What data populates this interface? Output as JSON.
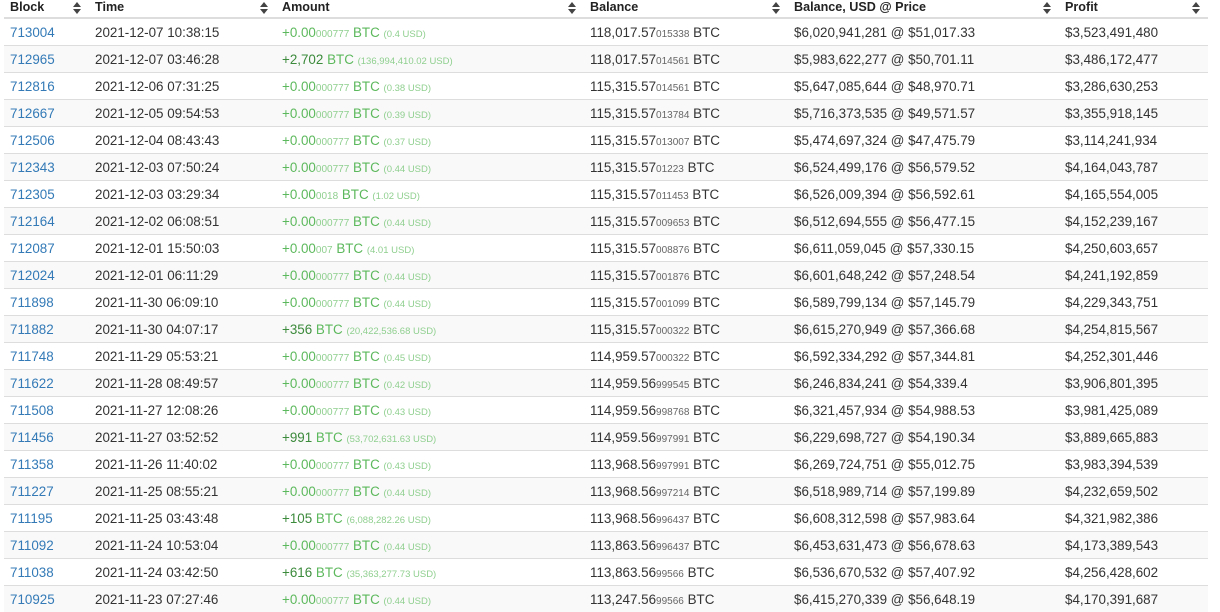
{
  "table": {
    "headers": [
      "Block",
      "Time",
      "Amount",
      "Balance",
      "Balance, USD @ Price",
      "Profit"
    ],
    "rows": [
      {
        "block": "713004",
        "time": "2021-12-07 10:38:15",
        "amt_main": "+0.00",
        "amt_small": "000777",
        "amt_unit": "BTC",
        "amt_usd": "(0.4 USD)",
        "bal_main": "118,017.57",
        "bal_small": "015338",
        "bal_unit": "BTC",
        "usd_price": "$6,020,941,281 @ $51,017.33",
        "profit": "$3,523,491,480"
      },
      {
        "block": "712965",
        "time": "2021-12-07 03:46:28",
        "amt_main": "+2,702",
        "amt_small": "",
        "amt_unit": "BTC",
        "amt_usd": "(136,994,410.02 USD)",
        "bal_main": "118,017.57",
        "bal_small": "014561",
        "bal_unit": "BTC",
        "usd_price": "$5,983,622,277 @ $50,701.11",
        "profit": "$3,486,172,477"
      },
      {
        "block": "712816",
        "time": "2021-12-06 07:31:25",
        "amt_main": "+0.00",
        "amt_small": "000777",
        "amt_unit": "BTC",
        "amt_usd": "(0.38 USD)",
        "bal_main": "115,315.57",
        "bal_small": "014561",
        "bal_unit": "BTC",
        "usd_price": "$5,647,085,644 @ $48,970.71",
        "profit": "$3,286,630,253"
      },
      {
        "block": "712667",
        "time": "2021-12-05 09:54:53",
        "amt_main": "+0.00",
        "amt_small": "000777",
        "amt_unit": "BTC",
        "amt_usd": "(0.39 USD)",
        "bal_main": "115,315.57",
        "bal_small": "013784",
        "bal_unit": "BTC",
        "usd_price": "$5,716,373,535 @ $49,571.57",
        "profit": "$3,355,918,145"
      },
      {
        "block": "712506",
        "time": "2021-12-04 08:43:43",
        "amt_main": "+0.00",
        "amt_small": "000777",
        "amt_unit": "BTC",
        "amt_usd": "(0.37 USD)",
        "bal_main": "115,315.57",
        "bal_small": "013007",
        "bal_unit": "BTC",
        "usd_price": "$5,474,697,324 @ $47,475.79",
        "profit": "$3,114,241,934"
      },
      {
        "block": "712343",
        "time": "2021-12-03 07:50:24",
        "amt_main": "+0.00",
        "amt_small": "000777",
        "amt_unit": "BTC",
        "amt_usd": "(0.44 USD)",
        "bal_main": "115,315.57",
        "bal_small": "01223",
        "bal_unit": "BTC",
        "usd_price": "$6,524,499,176 @ $56,579.52",
        "profit": "$4,164,043,787"
      },
      {
        "block": "712305",
        "time": "2021-12-03 03:29:34",
        "amt_main": "+0.00",
        "amt_small": "0018",
        "amt_unit": "BTC",
        "amt_usd": "(1.02 USD)",
        "bal_main": "115,315.57",
        "bal_small": "011453",
        "bal_unit": "BTC",
        "usd_price": "$6,526,009,394 @ $56,592.61",
        "profit": "$4,165,554,005"
      },
      {
        "block": "712164",
        "time": "2021-12-02 06:08:51",
        "amt_main": "+0.00",
        "amt_small": "000777",
        "amt_unit": "BTC",
        "amt_usd": "(0.44 USD)",
        "bal_main": "115,315.57",
        "bal_small": "009653",
        "bal_unit": "BTC",
        "usd_price": "$6,512,694,555 @ $56,477.15",
        "profit": "$4,152,239,167"
      },
      {
        "block": "712087",
        "time": "2021-12-01 15:50:03",
        "amt_main": "+0.00",
        "amt_small": "007",
        "amt_unit": "BTC",
        "amt_usd": "(4.01 USD)",
        "bal_main": "115,315.57",
        "bal_small": "008876",
        "bal_unit": "BTC",
        "usd_price": "$6,611,059,045 @ $57,330.15",
        "profit": "$4,250,603,657"
      },
      {
        "block": "712024",
        "time": "2021-12-01 06:11:29",
        "amt_main": "+0.00",
        "amt_small": "000777",
        "amt_unit": "BTC",
        "amt_usd": "(0.44 USD)",
        "bal_main": "115,315.57",
        "bal_small": "001876",
        "bal_unit": "BTC",
        "usd_price": "$6,601,648,242 @ $57,248.54",
        "profit": "$4,241,192,859"
      },
      {
        "block": "711898",
        "time": "2021-11-30 06:09:10",
        "amt_main": "+0.00",
        "amt_small": "000777",
        "amt_unit": "BTC",
        "amt_usd": "(0.44 USD)",
        "bal_main": "115,315.57",
        "bal_small": "001099",
        "bal_unit": "BTC",
        "usd_price": "$6,589,799,134 @ $57,145.79",
        "profit": "$4,229,343,751"
      },
      {
        "block": "711882",
        "time": "2021-11-30 04:07:17",
        "amt_main": "+356",
        "amt_small": "",
        "amt_unit": "BTC",
        "amt_usd": "(20,422,536.68 USD)",
        "bal_main": "115,315.57",
        "bal_small": "000322",
        "bal_unit": "BTC",
        "usd_price": "$6,615,270,949 @ $57,366.68",
        "profit": "$4,254,815,567"
      },
      {
        "block": "711748",
        "time": "2021-11-29 05:53:21",
        "amt_main": "+0.00",
        "amt_small": "000777",
        "amt_unit": "BTC",
        "amt_usd": "(0.45 USD)",
        "bal_main": "114,959.57",
        "bal_small": "000322",
        "bal_unit": "BTC",
        "usd_price": "$6,592,334,292 @ $57,344.81",
        "profit": "$4,252,301,446"
      },
      {
        "block": "711622",
        "time": "2021-11-28 08:49:57",
        "amt_main": "+0.00",
        "amt_small": "000777",
        "amt_unit": "BTC",
        "amt_usd": "(0.42 USD)",
        "bal_main": "114,959.56",
        "bal_small": "999545",
        "bal_unit": "BTC",
        "usd_price": "$6,246,834,241 @ $54,339.4",
        "profit": "$3,906,801,395"
      },
      {
        "block": "711508",
        "time": "2021-11-27 12:08:26",
        "amt_main": "+0.00",
        "amt_small": "000777",
        "amt_unit": "BTC",
        "amt_usd": "(0.43 USD)",
        "bal_main": "114,959.56",
        "bal_small": "998768",
        "bal_unit": "BTC",
        "usd_price": "$6,321,457,934 @ $54,988.53",
        "profit": "$3,981,425,089"
      },
      {
        "block": "711456",
        "time": "2021-11-27 03:52:52",
        "amt_main": "+991",
        "amt_small": "",
        "amt_unit": "BTC",
        "amt_usd": "(53,702,631.63 USD)",
        "bal_main": "114,959.56",
        "bal_small": "997991",
        "bal_unit": "BTC",
        "usd_price": "$6,229,698,727 @ $54,190.34",
        "profit": "$3,889,665,883"
      },
      {
        "block": "711358",
        "time": "2021-11-26 11:40:02",
        "amt_main": "+0.00",
        "amt_small": "000777",
        "amt_unit": "BTC",
        "amt_usd": "(0.43 USD)",
        "bal_main": "113,968.56",
        "bal_small": "997991",
        "bal_unit": "BTC",
        "usd_price": "$6,269,724,751 @ $55,012.75",
        "profit": "$3,983,394,539"
      },
      {
        "block": "711227",
        "time": "2021-11-25 08:55:21",
        "amt_main": "+0.00",
        "amt_small": "000777",
        "amt_unit": "BTC",
        "amt_usd": "(0.44 USD)",
        "bal_main": "113,968.56",
        "bal_small": "997214",
        "bal_unit": "BTC",
        "usd_price": "$6,518,989,714 @ $57,199.89",
        "profit": "$4,232,659,502"
      },
      {
        "block": "711195",
        "time": "2021-11-25 03:43:48",
        "amt_main": "+105",
        "amt_small": "",
        "amt_unit": "BTC",
        "amt_usd": "(6,088,282.26 USD)",
        "bal_main": "113,968.56",
        "bal_small": "996437",
        "bal_unit": "BTC",
        "usd_price": "$6,608,312,598 @ $57,983.64",
        "profit": "$4,321,982,386"
      },
      {
        "block": "711092",
        "time": "2021-11-24 10:53:04",
        "amt_main": "+0.00",
        "amt_small": "000777",
        "amt_unit": "BTC",
        "amt_usd": "(0.44 USD)",
        "bal_main": "113,863.56",
        "bal_small": "996437",
        "bal_unit": "BTC",
        "usd_price": "$6,453,631,473 @ $56,678.63",
        "profit": "$4,173,389,543"
      },
      {
        "block": "711038",
        "time": "2021-11-24 03:42:50",
        "amt_main": "+616",
        "amt_small": "",
        "amt_unit": "BTC",
        "amt_usd": "(35,363,277.73 USD)",
        "bal_main": "113,863.56",
        "bal_small": "99566",
        "bal_unit": "BTC",
        "usd_price": "$6,536,670,532 @ $57,407.92",
        "profit": "$4,256,428,602"
      },
      {
        "block": "710925",
        "time": "2021-11-23 07:27:46",
        "amt_main": "+0.00",
        "amt_small": "000777",
        "amt_unit": "BTC",
        "amt_usd": "(0.44 USD)",
        "bal_main": "113,247.56",
        "bal_small": "99566",
        "bal_unit": "BTC",
        "usd_price": "$6,415,270,339 @ $56,648.19",
        "profit": "$4,170,391,687"
      }
    ]
  }
}
